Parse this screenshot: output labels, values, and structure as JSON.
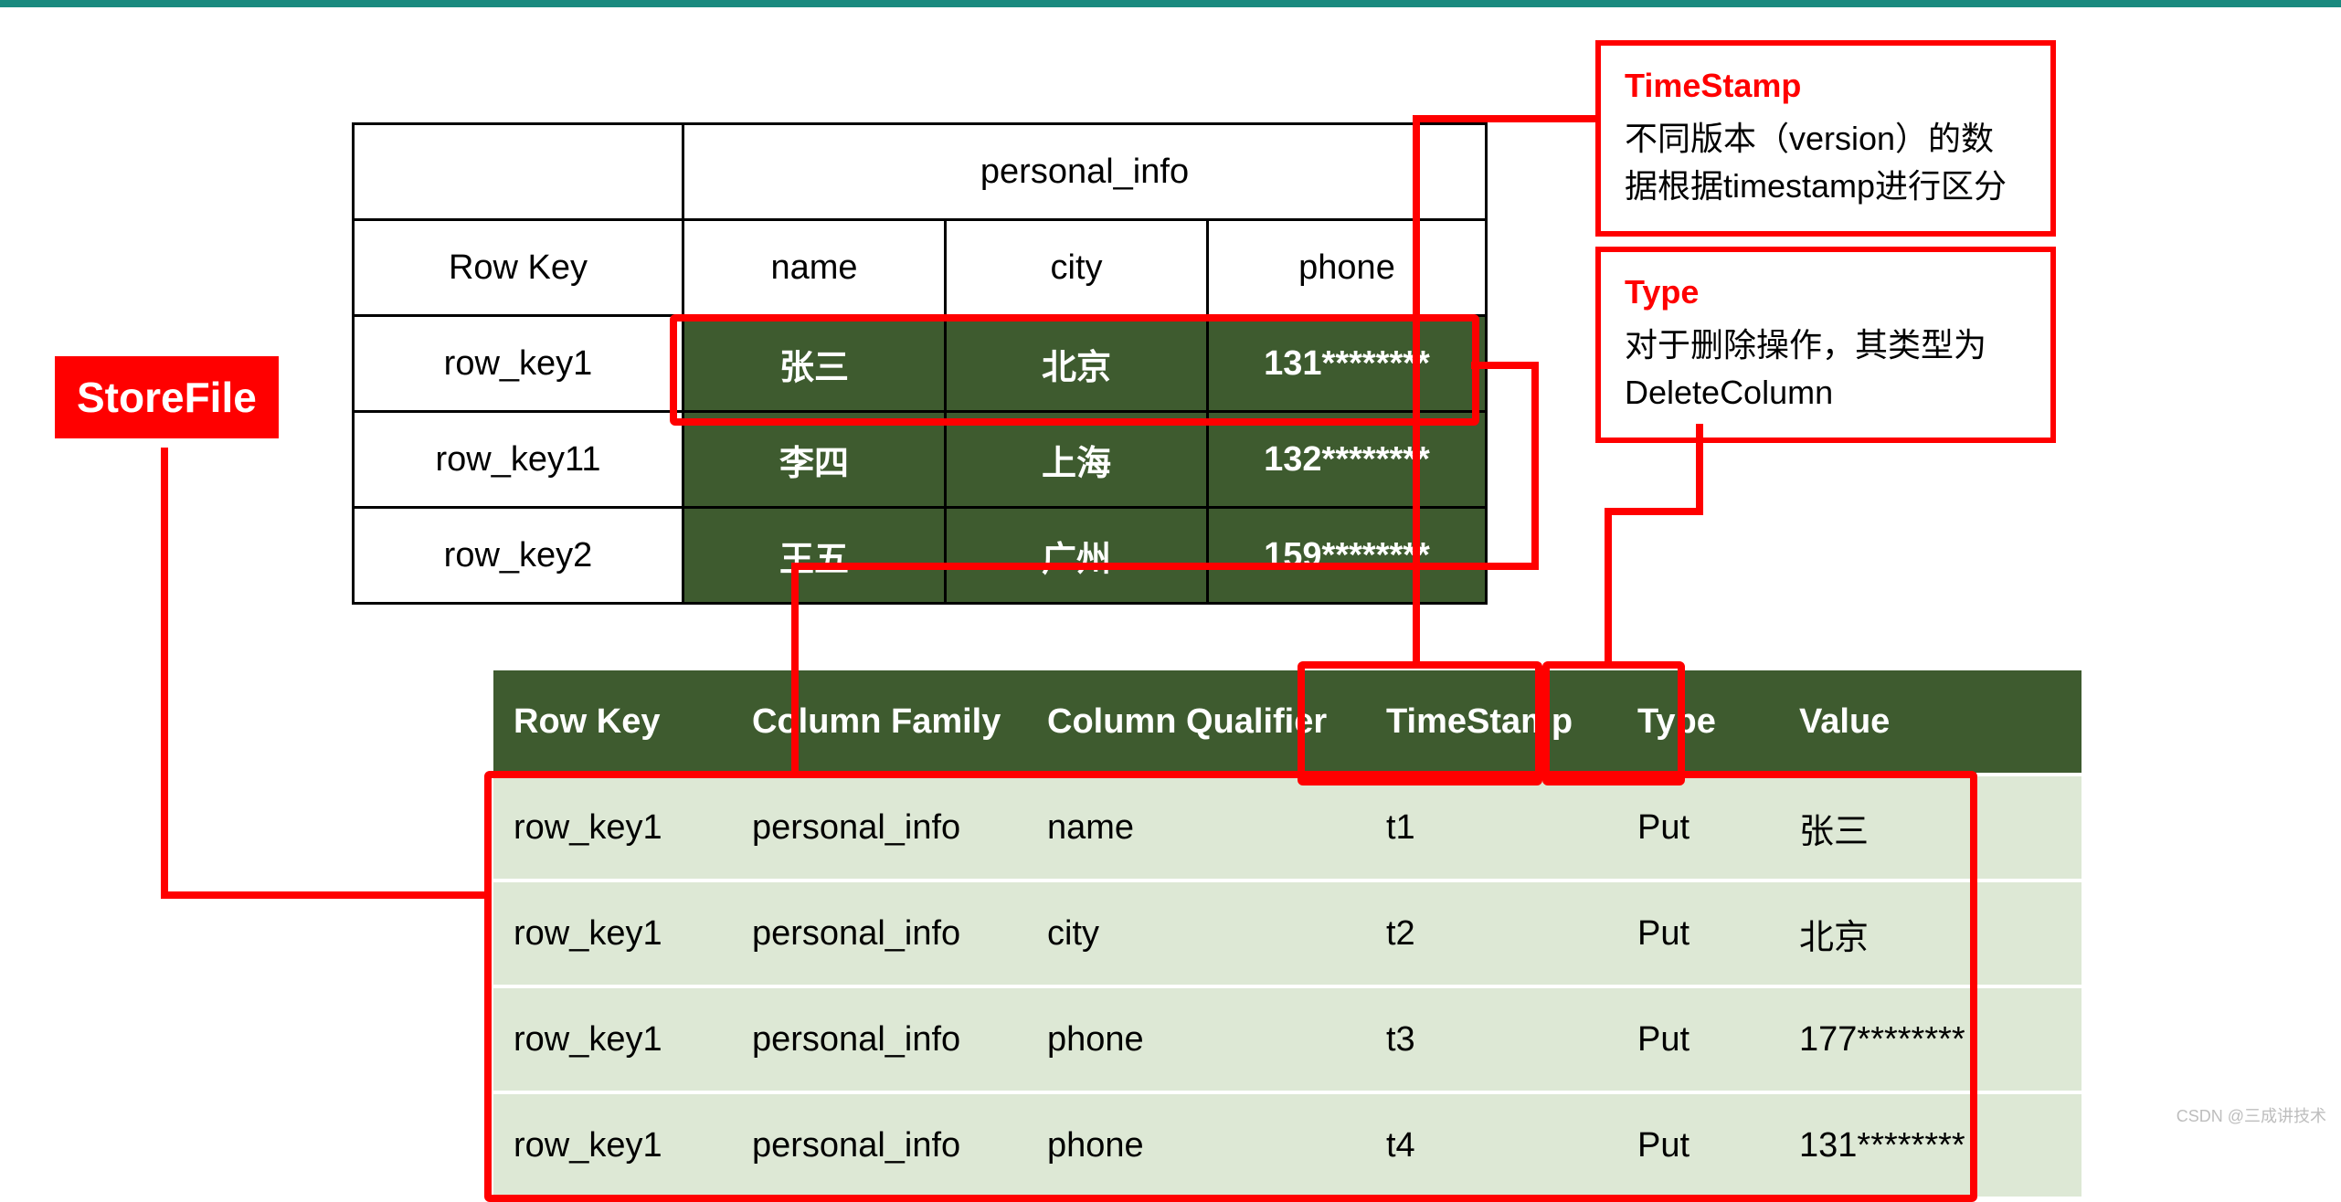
{
  "colors": {
    "accent": "#ff0000",
    "header_green": "#3e5b2f",
    "row_green": "#dde8d5",
    "teal_bar": "#1a8a7f"
  },
  "badge": {
    "label": "StoreFile"
  },
  "top_table": {
    "family_header": "personal_info",
    "row_key_header": "Row Key",
    "columns": {
      "name": "name",
      "city": "city",
      "phone": "phone"
    },
    "rows": [
      {
        "row_key": "row_key1",
        "name": "张三",
        "city": "北京",
        "phone": "131********"
      },
      {
        "row_key": "row_key11",
        "name": "李四",
        "city": "上海",
        "phone": "132********"
      },
      {
        "row_key": "row_key2",
        "name": "王五",
        "city": "广州",
        "phone": "159********"
      }
    ]
  },
  "bottom_table": {
    "headers": {
      "row_key": "Row Key",
      "column_family": "Column Family",
      "column_qualifier": "Column Qualifier",
      "timestamp": "TimeStamp",
      "type": "Type",
      "value": "Value"
    },
    "rows": [
      {
        "row_key": "row_key1",
        "cf": "personal_info",
        "cq": "name",
        "ts": "t1",
        "type": "Put",
        "value": "张三"
      },
      {
        "row_key": "row_key1",
        "cf": "personal_info",
        "cq": "city",
        "ts": "t2",
        "type": "Put",
        "value": "北京"
      },
      {
        "row_key": "row_key1",
        "cf": "personal_info",
        "cq": "phone",
        "ts": "t3",
        "type": "Put",
        "value": "177********"
      },
      {
        "row_key": "row_key1",
        "cf": "personal_info",
        "cq": "phone",
        "ts": "t4",
        "type": "Put",
        "value": "131********"
      }
    ]
  },
  "callouts": {
    "timestamp": {
      "title": "TimeStamp",
      "body": "不同版本（version）的数据根据timestamp进行区分"
    },
    "type": {
      "title": "Type",
      "body": "对于删除操作，其类型为DeleteColumn"
    }
  },
  "watermark": "CSDN @三成讲技术"
}
